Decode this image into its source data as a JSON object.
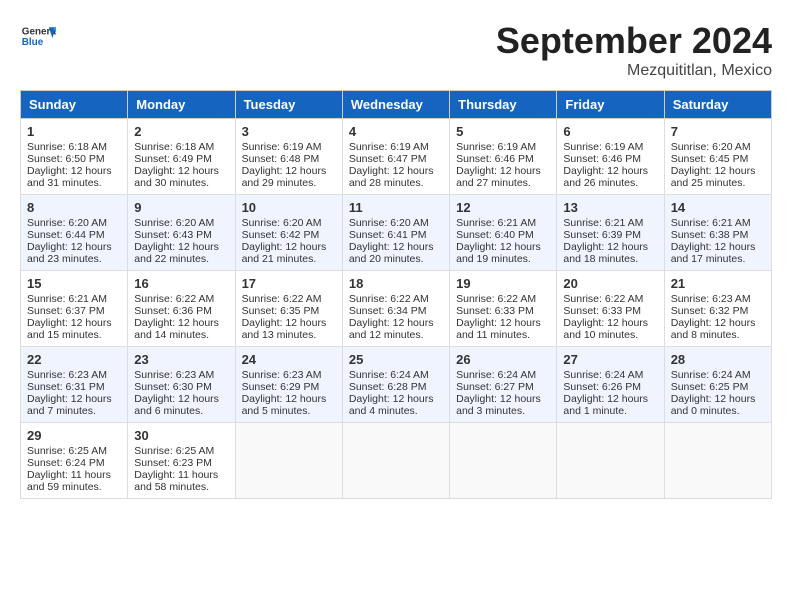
{
  "header": {
    "logo_general": "General",
    "logo_blue": "Blue",
    "month_title": "September 2024",
    "location": "Mezquititlan, Mexico"
  },
  "days_of_week": [
    "Sunday",
    "Monday",
    "Tuesday",
    "Wednesday",
    "Thursday",
    "Friday",
    "Saturday"
  ],
  "weeks": [
    [
      {
        "day": "1",
        "sunrise": "6:18 AM",
        "sunset": "6:50 PM",
        "daylight": "12 hours and 31 minutes."
      },
      {
        "day": "2",
        "sunrise": "6:18 AM",
        "sunset": "6:49 PM",
        "daylight": "12 hours and 30 minutes."
      },
      {
        "day": "3",
        "sunrise": "6:19 AM",
        "sunset": "6:48 PM",
        "daylight": "12 hours and 29 minutes."
      },
      {
        "day": "4",
        "sunrise": "6:19 AM",
        "sunset": "6:47 PM",
        "daylight": "12 hours and 28 minutes."
      },
      {
        "day": "5",
        "sunrise": "6:19 AM",
        "sunset": "6:46 PM",
        "daylight": "12 hours and 27 minutes."
      },
      {
        "day": "6",
        "sunrise": "6:19 AM",
        "sunset": "6:46 PM",
        "daylight": "12 hours and 26 minutes."
      },
      {
        "day": "7",
        "sunrise": "6:20 AM",
        "sunset": "6:45 PM",
        "daylight": "12 hours and 25 minutes."
      }
    ],
    [
      {
        "day": "8",
        "sunrise": "6:20 AM",
        "sunset": "6:44 PM",
        "daylight": "12 hours and 23 minutes."
      },
      {
        "day": "9",
        "sunrise": "6:20 AM",
        "sunset": "6:43 PM",
        "daylight": "12 hours and 22 minutes."
      },
      {
        "day": "10",
        "sunrise": "6:20 AM",
        "sunset": "6:42 PM",
        "daylight": "12 hours and 21 minutes."
      },
      {
        "day": "11",
        "sunrise": "6:20 AM",
        "sunset": "6:41 PM",
        "daylight": "12 hours and 20 minutes."
      },
      {
        "day": "12",
        "sunrise": "6:21 AM",
        "sunset": "6:40 PM",
        "daylight": "12 hours and 19 minutes."
      },
      {
        "day": "13",
        "sunrise": "6:21 AM",
        "sunset": "6:39 PM",
        "daylight": "12 hours and 18 minutes."
      },
      {
        "day": "14",
        "sunrise": "6:21 AM",
        "sunset": "6:38 PM",
        "daylight": "12 hours and 17 minutes."
      }
    ],
    [
      {
        "day": "15",
        "sunrise": "6:21 AM",
        "sunset": "6:37 PM",
        "daylight": "12 hours and 15 minutes."
      },
      {
        "day": "16",
        "sunrise": "6:22 AM",
        "sunset": "6:36 PM",
        "daylight": "12 hours and 14 minutes."
      },
      {
        "day": "17",
        "sunrise": "6:22 AM",
        "sunset": "6:35 PM",
        "daylight": "12 hours and 13 minutes."
      },
      {
        "day": "18",
        "sunrise": "6:22 AM",
        "sunset": "6:34 PM",
        "daylight": "12 hours and 12 minutes."
      },
      {
        "day": "19",
        "sunrise": "6:22 AM",
        "sunset": "6:33 PM",
        "daylight": "12 hours and 11 minutes."
      },
      {
        "day": "20",
        "sunrise": "6:22 AM",
        "sunset": "6:33 PM",
        "daylight": "12 hours and 10 minutes."
      },
      {
        "day": "21",
        "sunrise": "6:23 AM",
        "sunset": "6:32 PM",
        "daylight": "12 hours and 8 minutes."
      }
    ],
    [
      {
        "day": "22",
        "sunrise": "6:23 AM",
        "sunset": "6:31 PM",
        "daylight": "12 hours and 7 minutes."
      },
      {
        "day": "23",
        "sunrise": "6:23 AM",
        "sunset": "6:30 PM",
        "daylight": "12 hours and 6 minutes."
      },
      {
        "day": "24",
        "sunrise": "6:23 AM",
        "sunset": "6:29 PM",
        "daylight": "12 hours and 5 minutes."
      },
      {
        "day": "25",
        "sunrise": "6:24 AM",
        "sunset": "6:28 PM",
        "daylight": "12 hours and 4 minutes."
      },
      {
        "day": "26",
        "sunrise": "6:24 AM",
        "sunset": "6:27 PM",
        "daylight": "12 hours and 3 minutes."
      },
      {
        "day": "27",
        "sunrise": "6:24 AM",
        "sunset": "6:26 PM",
        "daylight": "12 hours and 1 minute."
      },
      {
        "day": "28",
        "sunrise": "6:24 AM",
        "sunset": "6:25 PM",
        "daylight": "12 hours and 0 minutes."
      }
    ],
    [
      {
        "day": "29",
        "sunrise": "6:25 AM",
        "sunset": "6:24 PM",
        "daylight": "11 hours and 59 minutes."
      },
      {
        "day": "30",
        "sunrise": "6:25 AM",
        "sunset": "6:23 PM",
        "daylight": "11 hours and 58 minutes."
      },
      null,
      null,
      null,
      null,
      null
    ]
  ],
  "labels": {
    "sunrise": "Sunrise:",
    "sunset": "Sunset:",
    "daylight": "Daylight:"
  }
}
